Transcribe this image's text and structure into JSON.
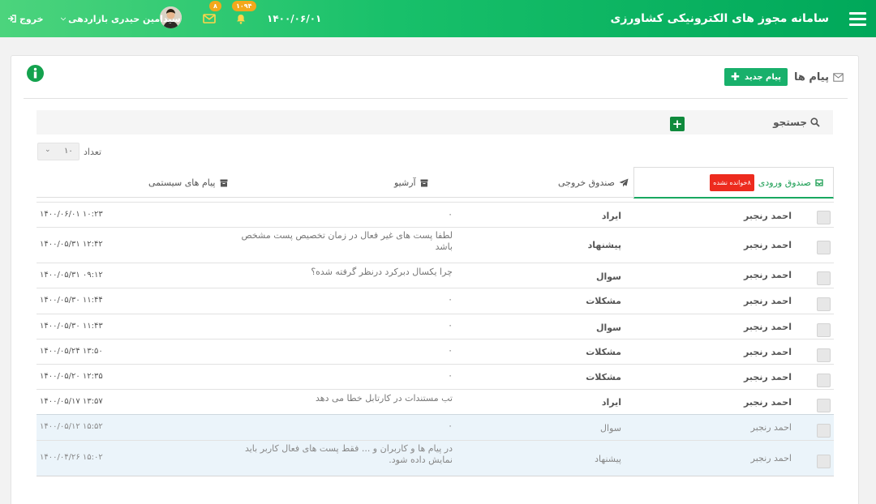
{
  "header": {
    "app_title": "سامانه مجوز های الکترونیکی کشاورزی",
    "date": "۱۴۰۰/۰۶/۰۱",
    "notifications_count": "۱۰۹۴",
    "messages_count": "۸",
    "user_name": "سیدامین حیدری بازاردهی",
    "logout_label": "خروج"
  },
  "messages": {
    "title": "پیام ها",
    "new_label": "پیام جدید",
    "search_label": "جستجو",
    "count_label": "تعداد",
    "count_value": "۱۰"
  },
  "tabs": {
    "inbox": "صندوق ورودی",
    "unread_badge": "۸خوانده نشده",
    "outbox": "صندوق خروجی",
    "archive": "آرشیو",
    "system": "پیام های سیستمی"
  },
  "rows": [
    {
      "from": "احمد رنجبر",
      "category": "ایراد",
      "body": "۰",
      "datetime": "۱۴۰۰/۰۶/۰۱ ۱۰:۲۳"
    },
    {
      "from": "احمد رنجبر",
      "category": "پیشنهاد",
      "body": "لطفا پست های غیر فعال در زمان تخصیص پست مشخص باشد",
      "datetime": "۱۴۰۰/۰۵/۳۱ ۱۲:۴۲"
    },
    {
      "from": "احمد رنجبر",
      "category": "سوال",
      "body": "چرا یکسال دبرکرد درنظر گرفته شده؟",
      "datetime": "۱۴۰۰/۰۵/۳۱ ۰۹:۱۲"
    },
    {
      "from": "احمد رنجبر",
      "category": "مشکلات",
      "body": "۰",
      "datetime": "۱۴۰۰/۰۵/۳۰ ۱۱:۴۴"
    },
    {
      "from": "احمد رنجبر",
      "category": "سوال",
      "body": "۰",
      "datetime": "۱۴۰۰/۰۵/۳۰ ۱۱:۴۳"
    },
    {
      "from": "احمد رنجبر",
      "category": "مشکلات",
      "body": "۰",
      "datetime": "۱۴۰۰/۰۵/۲۴ ۱۳:۵۰"
    },
    {
      "from": "احمد رنجبر",
      "category": "مشکلات",
      "body": "۰",
      "datetime": "۱۴۰۰/۰۵/۲۰ ۱۲:۳۵"
    },
    {
      "from": "احمد رنجبر",
      "category": "ایراد",
      "body": "تب مستندات در کارتابل خطا می دهد",
      "datetime": "۱۴۰۰/۰۵/۱۷ ۱۳:۵۷"
    },
    {
      "from": "احمد رنجبر",
      "category": "سوال",
      "body": "۰",
      "datetime": "۱۴۰۰/۰۵/۱۲ ۱۵:۵۲"
    },
    {
      "from": "احمد رنجبر",
      "category": "پیشنهاد",
      "body": "در پیام ها و کاربران و ... فقط پست های فعال کاربر باید نمایش داده شود.",
      "datetime": "۱۴۰۰/۰۴/۲۶ ۱۵:۰۲"
    }
  ]
}
